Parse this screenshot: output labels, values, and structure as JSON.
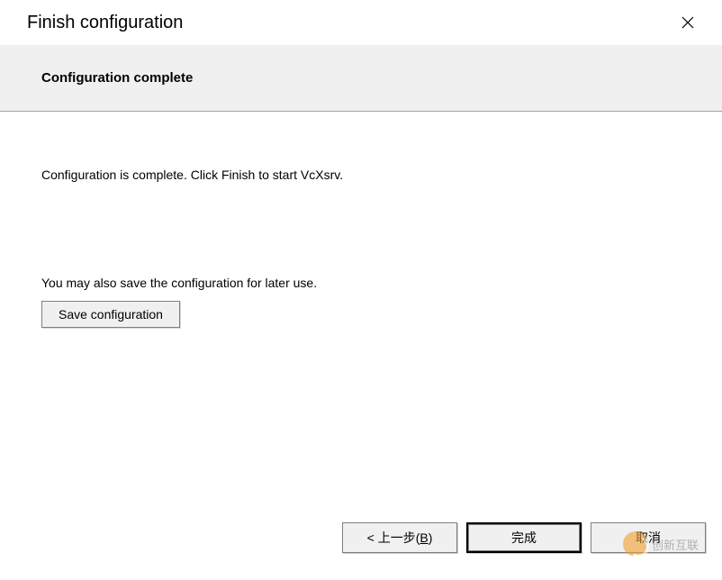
{
  "window": {
    "title": "Finish configuration"
  },
  "header": {
    "title": "Configuration complete"
  },
  "content": {
    "completion_message": "Configuration is complete. Click Finish to start VcXsrv.",
    "save_prompt": "You may also save the configuration for later use.",
    "save_button_label": "Save configuration"
  },
  "buttons": {
    "back_prefix": "< 上一步(",
    "back_hotkey": "B",
    "back_suffix": ")",
    "finish": "完成",
    "cancel": "取消"
  },
  "watermark": {
    "text": "创新互联"
  }
}
